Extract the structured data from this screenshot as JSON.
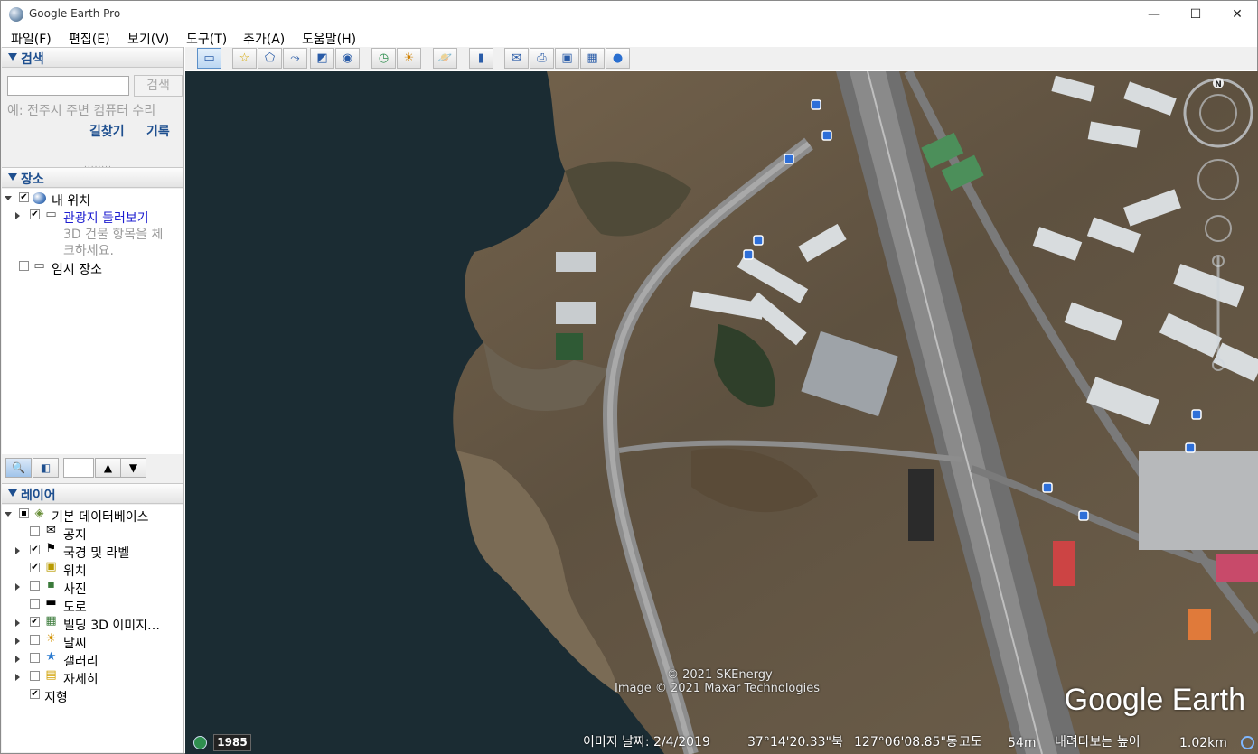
{
  "window": {
    "title": "Google Earth Pro",
    "minimize": "—",
    "maximize": "☐",
    "close": "✕"
  },
  "menu": [
    "파일(F)",
    "편집(E)",
    "보기(V)",
    "도구(T)",
    "추가(A)",
    "도움말(H)"
  ],
  "search": {
    "section_title": "검색",
    "input_value": "",
    "button_label": "검색",
    "hint": "예: 전주시 주변 컴퓨터 수리",
    "directions_link": "길찾기",
    "history_link": "기록"
  },
  "places": {
    "section_title": "장소",
    "items": [
      {
        "label": "내 위치",
        "checked": true,
        "icon": "globe-icon"
      },
      {
        "label": "관광지 둘러보기",
        "checked": true,
        "icon": "folder-icon"
      },
      {
        "label": "3D 건물 항목을 체",
        "icon": ""
      },
      {
        "label": "크하세요.",
        "icon": ""
      },
      {
        "label": "임시 장소",
        "checked": false,
        "icon": "folder-icon"
      }
    ]
  },
  "layers": {
    "section_title": "레이어",
    "items": [
      {
        "label": "기본 데이터베이스",
        "state": "mixed",
        "icon": "layers-icon"
      },
      {
        "label": "공지",
        "state": "off",
        "icon": "mail-icon"
      },
      {
        "label": "국경 및 라벨",
        "state": "on",
        "icon": "flag-icon"
      },
      {
        "label": "위치",
        "state": "on",
        "icon": "place-icon"
      },
      {
        "label": "사진",
        "state": "off",
        "icon": "photo-icon"
      },
      {
        "label": "도로",
        "state": "off",
        "icon": "road-icon"
      },
      {
        "label": "빌딩 3D 이미지…",
        "state": "on",
        "icon": "building-icon"
      },
      {
        "label": "날씨",
        "state": "off",
        "icon": "sun-icon"
      },
      {
        "label": "갤러리",
        "state": "off",
        "icon": "star-icon"
      },
      {
        "label": "자세히",
        "state": "off",
        "icon": "note-icon"
      },
      {
        "label": "지형",
        "state": "on",
        "icon": ""
      }
    ]
  },
  "map": {
    "copyright_1": "© 2021 SKEnergy",
    "copyright_2": "Image © 2021 Maxar Technologies",
    "logo": "Google Earth",
    "year": "1985",
    "imagery_date": "이미지 날짜: 2/4/2019",
    "latitude": "37°14'20.33\"북",
    "longitude": "127°06'08.85\"동",
    "elevation_label": "고도",
    "elevation_value": "54m",
    "eye_alt_label": "내려다보는 높이",
    "eye_alt_value": "1.02km",
    "north_label": "N"
  },
  "colors": {
    "accent": "#1e4f8f",
    "water": "#1b2c33",
    "land": "#6b5a43"
  }
}
